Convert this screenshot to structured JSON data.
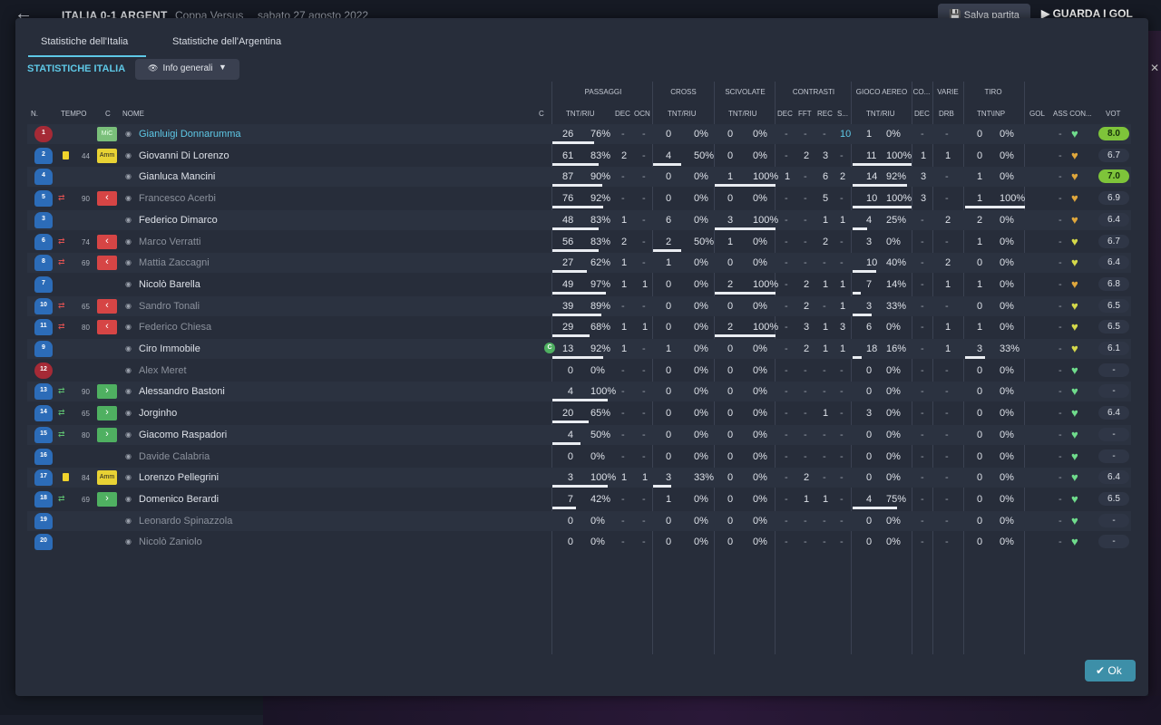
{
  "header": {
    "title": "ITALIA 0-1 ARGENT",
    "competition": "Coppa Versus",
    "date": "sabato 27 agosto 2022",
    "save_label": "Salva partita",
    "watch_label": "GUARDA I GOL"
  },
  "tabs": [
    "Statistiche dell'Italia",
    "Statistiche dell'Argentina"
  ],
  "section_title": "STATISTICHE ITALIA",
  "dropdown_label": "Info generali",
  "group_headers": [
    "PASSAGGI",
    "CROSS",
    "SCIVOLATE",
    "CONTRASTI",
    "GIOCO AEREO",
    "CO...",
    "VARIE",
    "TIRO"
  ],
  "columns": {
    "n": "N.",
    "tempo": "TEMPO",
    "c": "C",
    "nome": "NOME",
    "c2": "C",
    "pass": "TNT/RIU",
    "dec": "DEC",
    "ocn": "OCN",
    "cross": "TNT/RIU",
    "sciv": "TNT/RIU",
    "cdec": "DEC",
    "cfft": "FFT",
    "crec": "REC",
    "cs": "S...",
    "aereo": "TNT/RIU",
    "codec": "DEC",
    "drb": "DRB",
    "tiro": "TNT\\INP",
    "gol": "GOL",
    "ass": "ASS CON...",
    "vot": "VOT"
  },
  "players": [
    {
      "n": "1",
      "gk": true,
      "tempo": "",
      "card": false,
      "sub": "",
      "badge": "MiC",
      "name": "Gianluigi Donnarumma",
      "active": true,
      "hl": true,
      "cap": false,
      "p1": "26",
      "p2": "76%",
      "pf": 0.76,
      "dec": "-",
      "ocn": "-",
      "cr1": "0",
      "cr2": "0%",
      "crf": 0,
      "sc1": "0",
      "sc2": "0%",
      "scf": 0,
      "cdec": "-",
      "cfft": "-",
      "crec": "-",
      "cs": "10",
      "a1": "1",
      "a2": "0%",
      "af": 0,
      "codec": "-",
      "drb": "-",
      "t1": "0",
      "t2": "0%",
      "tf": 0,
      "gol": "",
      "ass": "-",
      "heart": "green",
      "vot": "8.0",
      "votg": true
    },
    {
      "n": "2",
      "gk": false,
      "tempo": "44",
      "card": true,
      "sub": "",
      "badge": "Amm",
      "name": "Giovanni Di Lorenzo",
      "active": true,
      "hl": false,
      "cap": false,
      "p1": "61",
      "p2": "83%",
      "pf": 0.83,
      "dec": "2",
      "ocn": "-",
      "cr1": "4",
      "cr2": "50%",
      "crf": 0.5,
      "sc1": "0",
      "sc2": "0%",
      "scf": 0,
      "cdec": "-",
      "cfft": "2",
      "crec": "3",
      "cs": "-",
      "a1": "11",
      "a2": "100%",
      "af": 1,
      "codec": "1",
      "drb": "1",
      "t1": "0",
      "t2": "0%",
      "tf": 0,
      "gol": "",
      "ass": "-",
      "heart": "orange",
      "vot": "6.7",
      "votg": false
    },
    {
      "n": "4",
      "gk": false,
      "tempo": "",
      "card": false,
      "sub": "",
      "badge": "",
      "name": "Gianluca Mancini",
      "active": true,
      "hl": false,
      "cap": false,
      "p1": "87",
      "p2": "90%",
      "pf": 0.9,
      "dec": "-",
      "ocn": "-",
      "cr1": "0",
      "cr2": "0%",
      "crf": 0,
      "sc1": "1",
      "sc2": "100%",
      "scf": 1,
      "cdec": "1",
      "cfft": "-",
      "crec": "6",
      "cs": "2",
      "a1": "14",
      "a2": "92%",
      "af": 0.92,
      "codec": "3",
      "drb": "-",
      "t1": "1",
      "t2": "0%",
      "tf": 0,
      "gol": "",
      "ass": "-",
      "heart": "orange",
      "vot": "7.0",
      "votg": true
    },
    {
      "n": "5",
      "gk": false,
      "tempo": "90",
      "card": false,
      "sub": "out",
      "badge": "out",
      "name": "Francesco Acerbi",
      "active": false,
      "hl": false,
      "cap": false,
      "p1": "76",
      "p2": "92%",
      "pf": 0.92,
      "dec": "-",
      "ocn": "-",
      "cr1": "0",
      "cr2": "0%",
      "crf": 0,
      "sc1": "0",
      "sc2": "0%",
      "scf": 0,
      "cdec": "-",
      "cfft": "-",
      "crec": "5",
      "cs": "-",
      "a1": "10",
      "a2": "100%",
      "af": 1,
      "codec": "3",
      "drb": "-",
      "t1": "1",
      "t2": "100%",
      "tf": 1,
      "gol": "",
      "ass": "-",
      "heart": "orange",
      "vot": "6.9",
      "votg": false
    },
    {
      "n": "3",
      "gk": false,
      "tempo": "",
      "card": false,
      "sub": "",
      "badge": "",
      "name": "Federico Dimarco",
      "active": true,
      "hl": false,
      "cap": false,
      "p1": "48",
      "p2": "83%",
      "pf": 0.83,
      "dec": "1",
      "ocn": "-",
      "cr1": "6",
      "cr2": "0%",
      "crf": 0,
      "sc1": "3",
      "sc2": "100%",
      "scf": 1,
      "cdec": "-",
      "cfft": "-",
      "crec": "1",
      "cs": "1",
      "a1": "4",
      "a2": "25%",
      "af": 0.25,
      "codec": "-",
      "drb": "2",
      "t1": "2",
      "t2": "0%",
      "tf": 0,
      "gol": "",
      "ass": "-",
      "heart": "orange",
      "vot": "6.4",
      "votg": false
    },
    {
      "n": "6",
      "gk": false,
      "tempo": "74",
      "card": false,
      "sub": "out",
      "badge": "out",
      "name": "Marco Verratti",
      "active": false,
      "hl": false,
      "cap": false,
      "p1": "56",
      "p2": "83%",
      "pf": 0.83,
      "dec": "2",
      "ocn": "-",
      "cr1": "2",
      "cr2": "50%",
      "crf": 0.5,
      "sc1": "1",
      "sc2": "0%",
      "scf": 0,
      "cdec": "-",
      "cfft": "-",
      "crec": "2",
      "cs": "-",
      "a1": "3",
      "a2": "0%",
      "af": 0,
      "codec": "-",
      "drb": "-",
      "t1": "1",
      "t2": "0%",
      "tf": 0,
      "gol": "",
      "ass": "-",
      "heart": "yellow",
      "vot": "6.7",
      "votg": false
    },
    {
      "n": "8",
      "gk": false,
      "tempo": "69",
      "card": false,
      "sub": "out",
      "badge": "out",
      "name": "Mattia Zaccagni",
      "active": false,
      "hl": false,
      "cap": false,
      "p1": "27",
      "p2": "62%",
      "pf": 0.62,
      "dec": "1",
      "ocn": "-",
      "cr1": "1",
      "cr2": "0%",
      "crf": 0,
      "sc1": "0",
      "sc2": "0%",
      "scf": 0,
      "cdec": "-",
      "cfft": "-",
      "crec": "-",
      "cs": "-",
      "a1": "10",
      "a2": "40%",
      "af": 0.4,
      "codec": "-",
      "drb": "2",
      "t1": "0",
      "t2": "0%",
      "tf": 0,
      "gol": "",
      "ass": "-",
      "heart": "yellow",
      "vot": "6.4",
      "votg": false
    },
    {
      "n": "7",
      "gk": false,
      "tempo": "",
      "card": false,
      "sub": "",
      "badge": "",
      "name": "Nicolò Barella",
      "active": true,
      "hl": false,
      "cap": false,
      "p1": "49",
      "p2": "97%",
      "pf": 0.97,
      "dec": "1",
      "ocn": "1",
      "cr1": "0",
      "cr2": "0%",
      "crf": 0,
      "sc1": "2",
      "sc2": "100%",
      "scf": 1,
      "cdec": "-",
      "cfft": "2",
      "crec": "1",
      "cs": "1",
      "a1": "7",
      "a2": "14%",
      "af": 0.14,
      "codec": "-",
      "drb": "1",
      "t1": "1",
      "t2": "0%",
      "tf": 0,
      "gol": "",
      "ass": "-",
      "heart": "orange",
      "vot": "6.8",
      "votg": false
    },
    {
      "n": "10",
      "gk": false,
      "tempo": "65",
      "card": false,
      "sub": "out",
      "badge": "out",
      "name": "Sandro Tonali",
      "active": false,
      "hl": false,
      "cap": false,
      "p1": "39",
      "p2": "89%",
      "pf": 0.89,
      "dec": "-",
      "ocn": "-",
      "cr1": "0",
      "cr2": "0%",
      "crf": 0,
      "sc1": "0",
      "sc2": "0%",
      "scf": 0,
      "cdec": "-",
      "cfft": "2",
      "crec": "-",
      "cs": "1",
      "a1": "3",
      "a2": "33%",
      "af": 0.33,
      "codec": "-",
      "drb": "-",
      "t1": "0",
      "t2": "0%",
      "tf": 0,
      "gol": "",
      "ass": "-",
      "heart": "yellow",
      "vot": "6.5",
      "votg": false
    },
    {
      "n": "11",
      "gk": false,
      "tempo": "80",
      "card": false,
      "sub": "out",
      "badge": "out",
      "name": "Federico Chiesa",
      "active": false,
      "hl": false,
      "cap": false,
      "p1": "29",
      "p2": "68%",
      "pf": 0.68,
      "dec": "1",
      "ocn": "1",
      "cr1": "0",
      "cr2": "0%",
      "crf": 0,
      "sc1": "2",
      "sc2": "100%",
      "scf": 1,
      "cdec": "-",
      "cfft": "3",
      "crec": "1",
      "cs": "3",
      "a1": "6",
      "a2": "0%",
      "af": 0,
      "codec": "-",
      "drb": "1",
      "t1": "1",
      "t2": "0%",
      "tf": 0,
      "gol": "",
      "ass": "-",
      "heart": "yellow",
      "vot": "6.5",
      "votg": false
    },
    {
      "n": "9",
      "gk": false,
      "tempo": "",
      "card": false,
      "sub": "",
      "badge": "",
      "name": "Ciro Immobile",
      "active": true,
      "hl": false,
      "cap": true,
      "p1": "13",
      "p2": "92%",
      "pf": 0.92,
      "dec": "1",
      "ocn": "-",
      "cr1": "1",
      "cr2": "0%",
      "crf": 0,
      "sc1": "0",
      "sc2": "0%",
      "scf": 0,
      "cdec": "-",
      "cfft": "2",
      "crec": "1",
      "cs": "1",
      "a1": "18",
      "a2": "16%",
      "af": 0.16,
      "codec": "-",
      "drb": "1",
      "t1": "3",
      "t2": "33%",
      "tf": 0.33,
      "gol": "",
      "ass": "-",
      "heart": "yellow",
      "vot": "6.1",
      "votg": false
    },
    {
      "n": "12",
      "gk": true,
      "tempo": "",
      "card": false,
      "sub": "",
      "badge": "",
      "name": "Alex Meret",
      "active": false,
      "hl": false,
      "cap": false,
      "p1": "0",
      "p2": "0%",
      "pf": 0,
      "dec": "-",
      "ocn": "-",
      "cr1": "0",
      "cr2": "0%",
      "crf": 0,
      "sc1": "0",
      "sc2": "0%",
      "scf": 0,
      "cdec": "-",
      "cfft": "-",
      "crec": "-",
      "cs": "-",
      "a1": "0",
      "a2": "0%",
      "af": 0,
      "codec": "-",
      "drb": "-",
      "t1": "0",
      "t2": "0%",
      "tf": 0,
      "gol": "",
      "ass": "-",
      "heart": "green",
      "vot": "-",
      "votg": false
    },
    {
      "n": "13",
      "gk": false,
      "tempo": "90",
      "card": false,
      "sub": "in",
      "badge": "in",
      "name": "Alessandro Bastoni",
      "active": true,
      "hl": false,
      "cap": false,
      "p1": "4",
      "p2": "100%",
      "pf": 1,
      "dec": "-",
      "ocn": "-",
      "cr1": "0",
      "cr2": "0%",
      "crf": 0,
      "sc1": "0",
      "sc2": "0%",
      "scf": 0,
      "cdec": "-",
      "cfft": "-",
      "crec": "-",
      "cs": "-",
      "a1": "0",
      "a2": "0%",
      "af": 0,
      "codec": "-",
      "drb": "-",
      "t1": "0",
      "t2": "0%",
      "tf": 0,
      "gol": "",
      "ass": "-",
      "heart": "green",
      "vot": "-",
      "votg": false
    },
    {
      "n": "14",
      "gk": false,
      "tempo": "65",
      "card": false,
      "sub": "in",
      "badge": "in",
      "name": "Jorginho",
      "active": true,
      "hl": false,
      "cap": false,
      "p1": "20",
      "p2": "65%",
      "pf": 0.65,
      "dec": "-",
      "ocn": "-",
      "cr1": "0",
      "cr2": "0%",
      "crf": 0,
      "sc1": "0",
      "sc2": "0%",
      "scf": 0,
      "cdec": "-",
      "cfft": "-",
      "crec": "1",
      "cs": "-",
      "a1": "3",
      "a2": "0%",
      "af": 0,
      "codec": "-",
      "drb": "-",
      "t1": "0",
      "t2": "0%",
      "tf": 0,
      "gol": "",
      "ass": "-",
      "heart": "green",
      "vot": "6.4",
      "votg": false
    },
    {
      "n": "15",
      "gk": false,
      "tempo": "80",
      "card": false,
      "sub": "in",
      "badge": "in",
      "name": "Giacomo Raspadori",
      "active": true,
      "hl": false,
      "cap": false,
      "p1": "4",
      "p2": "50%",
      "pf": 0.5,
      "dec": "-",
      "ocn": "-",
      "cr1": "0",
      "cr2": "0%",
      "crf": 0,
      "sc1": "0",
      "sc2": "0%",
      "scf": 0,
      "cdec": "-",
      "cfft": "-",
      "crec": "-",
      "cs": "-",
      "a1": "0",
      "a2": "0%",
      "af": 0,
      "codec": "-",
      "drb": "-",
      "t1": "0",
      "t2": "0%",
      "tf": 0,
      "gol": "",
      "ass": "-",
      "heart": "green",
      "vot": "-",
      "votg": false
    },
    {
      "n": "16",
      "gk": false,
      "tempo": "",
      "card": false,
      "sub": "",
      "badge": "",
      "name": "Davide Calabria",
      "active": false,
      "hl": false,
      "cap": false,
      "p1": "0",
      "p2": "0%",
      "pf": 0,
      "dec": "-",
      "ocn": "-",
      "cr1": "0",
      "cr2": "0%",
      "crf": 0,
      "sc1": "0",
      "sc2": "0%",
      "scf": 0,
      "cdec": "-",
      "cfft": "-",
      "crec": "-",
      "cs": "-",
      "a1": "0",
      "a2": "0%",
      "af": 0,
      "codec": "-",
      "drb": "-",
      "t1": "0",
      "t2": "0%",
      "tf": 0,
      "gol": "",
      "ass": "-",
      "heart": "green",
      "vot": "-",
      "votg": false
    },
    {
      "n": "17",
      "gk": false,
      "tempo": "84",
      "card": true,
      "sub": "",
      "badge": "Amm",
      "name": "Lorenzo Pellegrini",
      "active": true,
      "hl": false,
      "cap": false,
      "p1": "3",
      "p2": "100%",
      "pf": 1,
      "dec": "1",
      "ocn": "1",
      "cr1": "3",
      "cr2": "33%",
      "crf": 0.33,
      "sc1": "0",
      "sc2": "0%",
      "scf": 0,
      "cdec": "-",
      "cfft": "2",
      "crec": "-",
      "cs": "-",
      "a1": "0",
      "a2": "0%",
      "af": 0,
      "codec": "-",
      "drb": "-",
      "t1": "0",
      "t2": "0%",
      "tf": 0,
      "gol": "",
      "ass": "-",
      "heart": "green",
      "vot": "6.4",
      "votg": false
    },
    {
      "n": "18",
      "gk": false,
      "tempo": "69",
      "card": false,
      "sub": "in",
      "badge": "in",
      "name": "Domenico Berardi",
      "active": true,
      "hl": false,
      "cap": false,
      "p1": "7",
      "p2": "42%",
      "pf": 0.42,
      "dec": "-",
      "ocn": "-",
      "cr1": "1",
      "cr2": "0%",
      "crf": 0,
      "sc1": "0",
      "sc2": "0%",
      "scf": 0,
      "cdec": "-",
      "cfft": "1",
      "crec": "1",
      "cs": "-",
      "a1": "4",
      "a2": "75%",
      "af": 0.75,
      "codec": "-",
      "drb": "-",
      "t1": "0",
      "t2": "0%",
      "tf": 0,
      "gol": "",
      "ass": "-",
      "heart": "green",
      "vot": "6.5",
      "votg": false
    },
    {
      "n": "19",
      "gk": false,
      "tempo": "",
      "card": false,
      "sub": "",
      "badge": "",
      "name": "Leonardo Spinazzola",
      "active": false,
      "hl": false,
      "cap": false,
      "p1": "0",
      "p2": "0%",
      "pf": 0,
      "dec": "-",
      "ocn": "-",
      "cr1": "0",
      "cr2": "0%",
      "crf": 0,
      "sc1": "0",
      "sc2": "0%",
      "scf": 0,
      "cdec": "-",
      "cfft": "-",
      "crec": "-",
      "cs": "-",
      "a1": "0",
      "a2": "0%",
      "af": 0,
      "codec": "-",
      "drb": "-",
      "t1": "0",
      "t2": "0%",
      "tf": 0,
      "gol": "",
      "ass": "-",
      "heart": "green",
      "vot": "-",
      "votg": false
    },
    {
      "n": "20",
      "gk": false,
      "tempo": "",
      "card": false,
      "sub": "",
      "badge": "",
      "name": "Nicolò Zaniolo",
      "active": false,
      "hl": false,
      "cap": false,
      "p1": "0",
      "p2": "0%",
      "pf": 0,
      "dec": "-",
      "ocn": "-",
      "cr1": "0",
      "cr2": "0%",
      "crf": 0,
      "sc1": "0",
      "sc2": "0%",
      "scf": 0,
      "cdec": "-",
      "cfft": "-",
      "crec": "-",
      "cs": "-",
      "a1": "0",
      "a2": "0%",
      "af": 0,
      "codec": "-",
      "drb": "-",
      "t1": "0",
      "t2": "0%",
      "tf": 0,
      "gol": "",
      "ass": "-",
      "heart": "green",
      "vot": "-",
      "votg": false
    }
  ],
  "ok_label": "Ok",
  "colors": {
    "accent": "#5ec8e6",
    "ok": "#3d8fa8",
    "rating_high": "#7ec43a"
  }
}
